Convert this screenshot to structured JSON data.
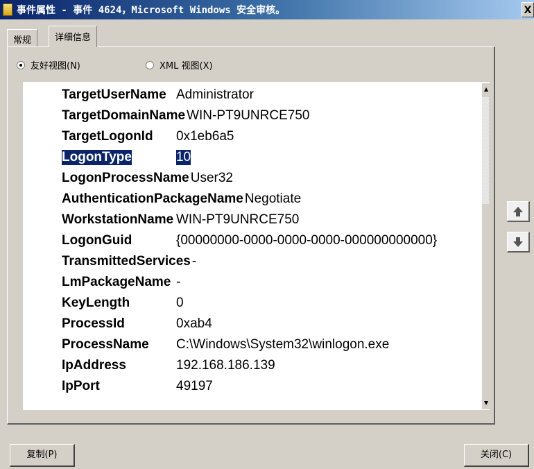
{
  "window": {
    "title": "事件属性 - 事件 4624，Microsoft Windows 安全审核。",
    "close": "X"
  },
  "tabs": [
    {
      "label": "常规"
    },
    {
      "label": "详细信息"
    }
  ],
  "views": {
    "friendly": "友好视图(N)",
    "xml": "XML 视图(X)",
    "selected": "friendly"
  },
  "fields": [
    {
      "key": "TargetUserName",
      "value": "Administrator"
    },
    {
      "key": "TargetDomainName",
      "value": "WIN-PT9UNRCE750"
    },
    {
      "key": "TargetLogonId",
      "value": "0x1eb6a5"
    },
    {
      "key": "LogonType",
      "value": "10"
    },
    {
      "key": "LogonProcessName",
      "value": "User32"
    },
    {
      "key": "AuthenticationPackageName",
      "value": "Negotiate"
    },
    {
      "key": "WorkstationName",
      "value": "WIN-PT9UNRCE750"
    },
    {
      "key": "LogonGuid",
      "value": "{00000000-0000-0000-0000-000000000000}"
    },
    {
      "key": "TransmittedServices",
      "value": "-"
    },
    {
      "key": "LmPackageName",
      "value": "-"
    },
    {
      "key": "KeyLength",
      "value": "0"
    },
    {
      "key": "ProcessId",
      "value": "0xab4"
    },
    {
      "key": "ProcessName",
      "value": "C:\\Windows\\System32\\winlogon.exe"
    },
    {
      "key": "IpAddress",
      "value": "192.168.186.139"
    },
    {
      "key": "IpPort",
      "value": "49197"
    }
  ],
  "buttons": {
    "copy": "复制(P)",
    "close": "关闭(C)"
  }
}
